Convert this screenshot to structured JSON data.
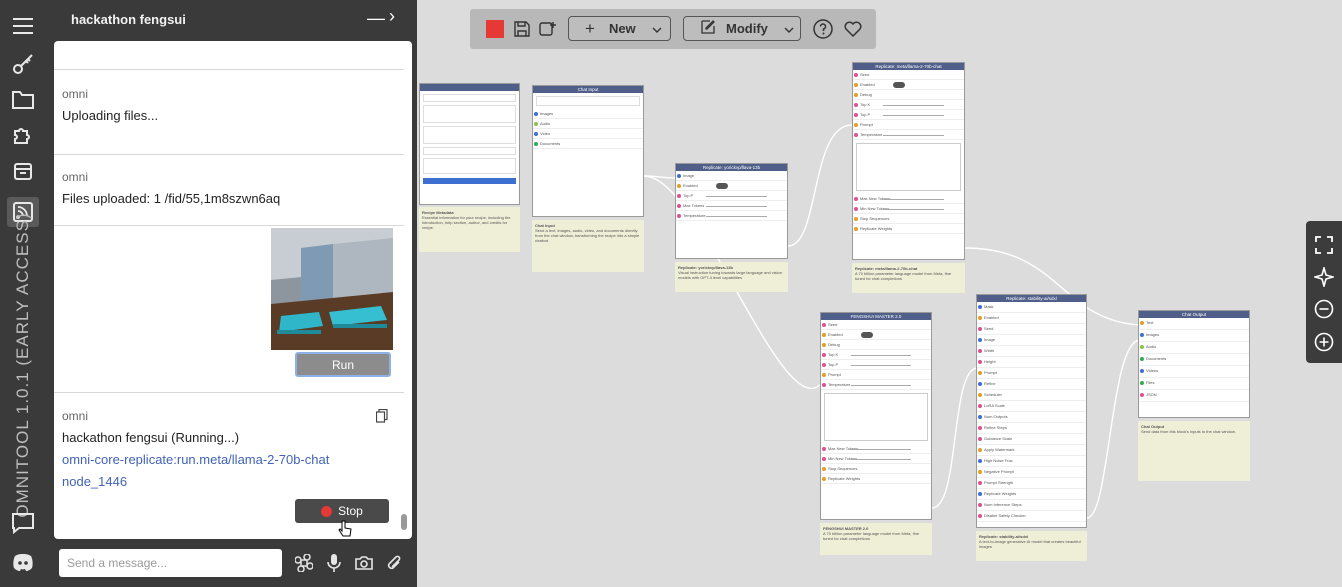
{
  "rail": {
    "brand": "OMNITOOL 1.0.1 (EARLY ACCESS)",
    "icons": [
      "menu-icon",
      "key-icon",
      "folder-icon",
      "puzzle-icon",
      "archive-icon",
      "chat-feed-icon",
      "message-icon",
      "discord-icon"
    ]
  },
  "chat": {
    "title": "hackathon fengsui",
    "messages": [
      {
        "author": "omni",
        "text": "Uploading files..."
      },
      {
        "author": "omni",
        "text": "Files uploaded: 1 /fid/55,1m8szwn6aq"
      },
      {
        "author": "omni",
        "text": "hackathon fengsui  (Running...)",
        "link1": "omni-core-replicate:run.meta/llama-2-70b-chat",
        "link2": "node_1446"
      }
    ],
    "run_label": "Run",
    "stop_label": "Stop",
    "input_placeholder": "Send a message..."
  },
  "toolbar": {
    "color": "#e53935",
    "new_label": "New",
    "modify_label": "Modify"
  },
  "nodes": {
    "recipe": {
      "title": "Recipe Metadata",
      "note": "Essential information for your recipe, including the introduction, help section, author, and credits for recipe."
    },
    "chat_input": {
      "title": "Chat Input",
      "rows": [
        "Images",
        "Audio",
        "Video",
        "Documents"
      ],
      "note": "Send a text, images, audio, video, and documents directly from the chat window, transforming the recipe into a simple chatbot."
    },
    "llava": {
      "title": "Replicate: yorickvp/llava-13b",
      "rows": [
        "Image",
        "Enabled",
        "Top P",
        "Max Tokens",
        "Temperature"
      ],
      "note": "Replicate: yorickvp/llava-13b",
      "note_text": "Visual instruction tuning towards large language and vision models with GPT-4 level capabilities"
    },
    "llama_top": {
      "title": "Replicate: meta/llama-2-70b-chat",
      "rows": [
        "Seed",
        "Enabled",
        "Debug",
        "Top K",
        "Top P",
        "Prompt",
        "Temperature",
        "Max New Tokens",
        "Min New Tokens",
        "Stop Sequences",
        "Replicate Weights"
      ],
      "note": "Replicate: meta/llama-2-70b-chat",
      "note_text": "A 70 billion parameter language model from Meta, fine tuned for chat completions"
    },
    "fengshui": {
      "title": "FENGSHUI MASTER 2.0",
      "rows": [
        "Seed",
        "Enabled",
        "Debug",
        "Top K",
        "Top P",
        "Prompt",
        "Temperature",
        "Max New Tokens",
        "Min New Tokens",
        "Stop Sequences",
        "Replicate Weights"
      ],
      "note": "FENGSHUI MASTER 2.0",
      "note_text": "A 70 billion parameter language model from Meta, fine tuned for chat completions"
    },
    "sdxl": {
      "title": "Replicate: stability-ai/sdxl",
      "rows": [
        "Mask",
        "Enabled",
        "Seed",
        "Image",
        "Width",
        "Height",
        "Prompt",
        "Refine",
        "Scheduler",
        "LoRA Scale",
        "Num Outputs",
        "Refine Steps",
        "Guidance Scale",
        "Apply Watermark",
        "High Noise Frac",
        "Negative Prompt",
        "Prompt Strength",
        "Replicate Weights",
        "Num Inference Steps",
        "Disable Safety Checker"
      ],
      "note": "Replicate: stability-ai/sdxl",
      "note_text": "A text-to-image generative AI model that creates beautiful images"
    },
    "chat_output": {
      "title": "Chat Output",
      "rows": [
        "Text",
        "Images",
        "Audio",
        "Documents",
        "Videos",
        "Files",
        "JSON"
      ],
      "note": "Chat Output",
      "note_text": "Send data from this block's inputs to the chat window."
    }
  }
}
